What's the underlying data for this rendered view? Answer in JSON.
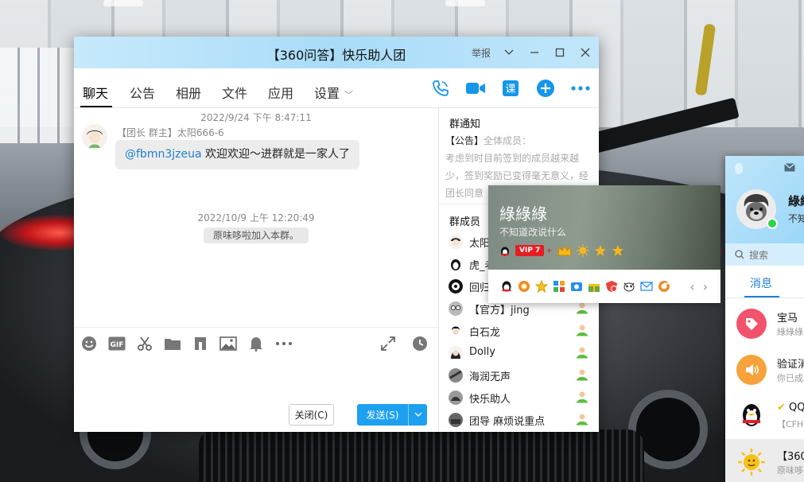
{
  "window": {
    "title": "【360问答】快乐助人团",
    "report_label": "举报"
  },
  "tabs": [
    {
      "label": "聊天",
      "active": true
    },
    {
      "label": "公告"
    },
    {
      "label": "相册"
    },
    {
      "label": "文件"
    },
    {
      "label": "应用"
    },
    {
      "label": "设置"
    }
  ],
  "quick_icons": [
    "call-icon",
    "video-icon",
    "lesson-icon",
    "add-icon",
    "more-icon"
  ],
  "messages": {
    "timestamp_1": "2022/9/24 下午 8:47:11",
    "sender": "【团长 群主】太阳666-6",
    "mention": "@fbmn3jzeua",
    "text": " 欢迎欢迎～进群就是一家人了",
    "timestamp_2": "2022/10/9 上午 12:20:49",
    "system_notice": "原味哆啦加入本群。"
  },
  "toolbar": {
    "tools": [
      "emoji-icon",
      "gif-icon",
      "scissors-icon",
      "folder-icon",
      "music-icon",
      "image-icon",
      "bell-icon",
      "more-dots-icon"
    ],
    "gif_label": "GIF"
  },
  "actions": {
    "close_label": "关闭(C)",
    "send_label": "发送(S)"
  },
  "notice": {
    "title": "群通知",
    "tag": "【公告】",
    "audience": "全体成员：",
    "body": "考虑到时目前签到的成员越来越少，签到奖励已变得毫无意义，经团长同意"
  },
  "members": {
    "title": "群成员",
    "list": [
      {
        "name": "太阳"
      },
      {
        "name": "虎_老"
      },
      {
        "name": "回归"
      },
      {
        "name": "【官方】jing"
      },
      {
        "name": "白石龙"
      },
      {
        "name": "Dolly"
      },
      {
        "name": "海润无声"
      },
      {
        "name": "快乐助人"
      },
      {
        "name": "团导 麻烦说重点"
      }
    ]
  },
  "profile_card": {
    "name": "綠綠綠",
    "signature": "不知道改说什么",
    "vip_label": "VIP 7",
    "plus": "+"
  },
  "qq_panel": {
    "name": "綠綠",
    "signature": "不知",
    "search_placeholder": "搜索",
    "tab_label": "消息",
    "items": [
      {
        "title": "宝马",
        "sub": "綠綠綠",
        "color": "#f2526b"
      },
      {
        "title": "验证消",
        "sub": "你已成",
        "color": "#f7a23a"
      },
      {
        "title": "QQ",
        "sub": "【CFH",
        "color": "#ffffff"
      },
      {
        "title": "【360",
        "sub": "原味哆",
        "color": "#fff3c4"
      }
    ]
  },
  "colors": {
    "accent": "#1ea0f0",
    "title_bar": "#a9dcf8",
    "mention": "#1d7fd0"
  }
}
